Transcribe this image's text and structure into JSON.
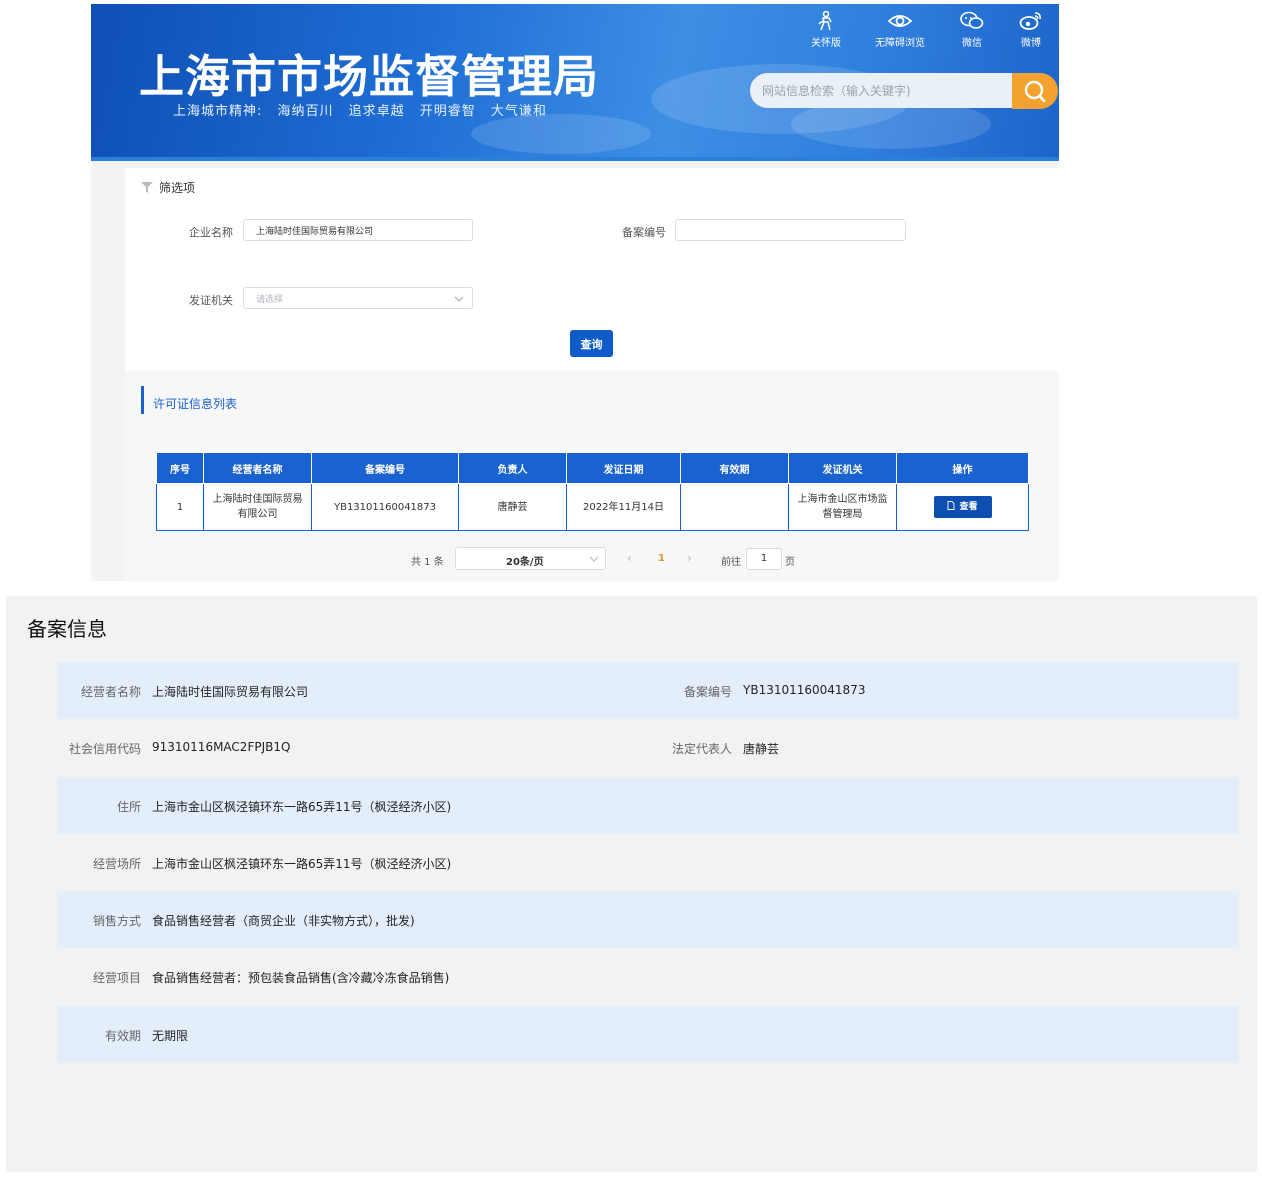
{
  "header": {
    "site_title": "上海市市场监督管理局",
    "slogan": "上海城市精神: 海纳百川  追求卓越  开明睿智  大气谦和",
    "links": [
      {
        "label": "关怀版",
        "icon": "elderly-care-icon"
      },
      {
        "label": "无障碍浏览",
        "icon": "eye-icon"
      },
      {
        "label": "微信",
        "icon": "wechat-icon"
      },
      {
        "label": "微博",
        "icon": "weibo-icon"
      }
    ],
    "search_placeholder": "网站信息检索（输入关键字)",
    "search_icon": "search-icon",
    "colors": {
      "banner": "#1f6fd6",
      "search_button": "#f4a22f"
    }
  },
  "filter": {
    "title": "筛选项",
    "company_label": "企业名称",
    "company_value": "上海陆时佳国际贸易有限公司",
    "record_no_label": "备案编号",
    "record_no_value": "",
    "authority_label": "发证机关",
    "authority_placeholder": "请选择",
    "query_label": "查询"
  },
  "list": {
    "title": "许可证信息列表",
    "columns": [
      "序号",
      "经营者名称",
      "备案编号",
      "负责人",
      "发证日期",
      "有效期",
      "发证机关",
      "操作"
    ],
    "rows": [
      {
        "index": "1",
        "operator": "上海陆时佳国际贸易有限公司",
        "record_no": "YB13101160041873",
        "person": "唐静芸",
        "issue_date": "2022年11月14日",
        "validity": "",
        "authority": "上海市金山区市场监督管理局",
        "action": "查看"
      }
    ],
    "pager": {
      "total": "共 1 条",
      "page_size": "20条/页",
      "prev": "‹",
      "current_page": "1",
      "next": "›",
      "goto_label": "前往",
      "goto_value": "1",
      "page_unit": "页"
    },
    "colors": {
      "accent": "#1a62d0"
    }
  },
  "detail": {
    "title": "备案信息",
    "fields": {
      "operator_label": "经营者名称",
      "operator_value": "上海陆时佳国际贸易有限公司",
      "record_no_label": "备案编号",
      "record_no_value": "YB13101160041873",
      "credit_code_label": "社会信用代码",
      "credit_code_value": "91310116MAC2FPJB1Q",
      "legal_rep_label": "法定代表人",
      "legal_rep_value": "唐静芸",
      "residence_label": "住所",
      "residence_value": "上海市金山区枫泾镇环东一路65弄11号（枫泾经济小区)",
      "premises_label": "经营场所",
      "premises_value": "上海市金山区枫泾镇环东一路65弄11号（枫泾经济小区)",
      "sales_mode_label": "销售方式",
      "sales_mode_value": "食品销售经营者（商贸企业（非实物方式），批发)",
      "business_scope_label": "经营项目",
      "business_scope_value": "食品销售经营者：预包装食品销售(含冷藏冷冻食品销售)",
      "validity_label": "有效期",
      "validity_value": "无期限"
    },
    "colors": {
      "row_shade": "#e4eefb"
    }
  }
}
